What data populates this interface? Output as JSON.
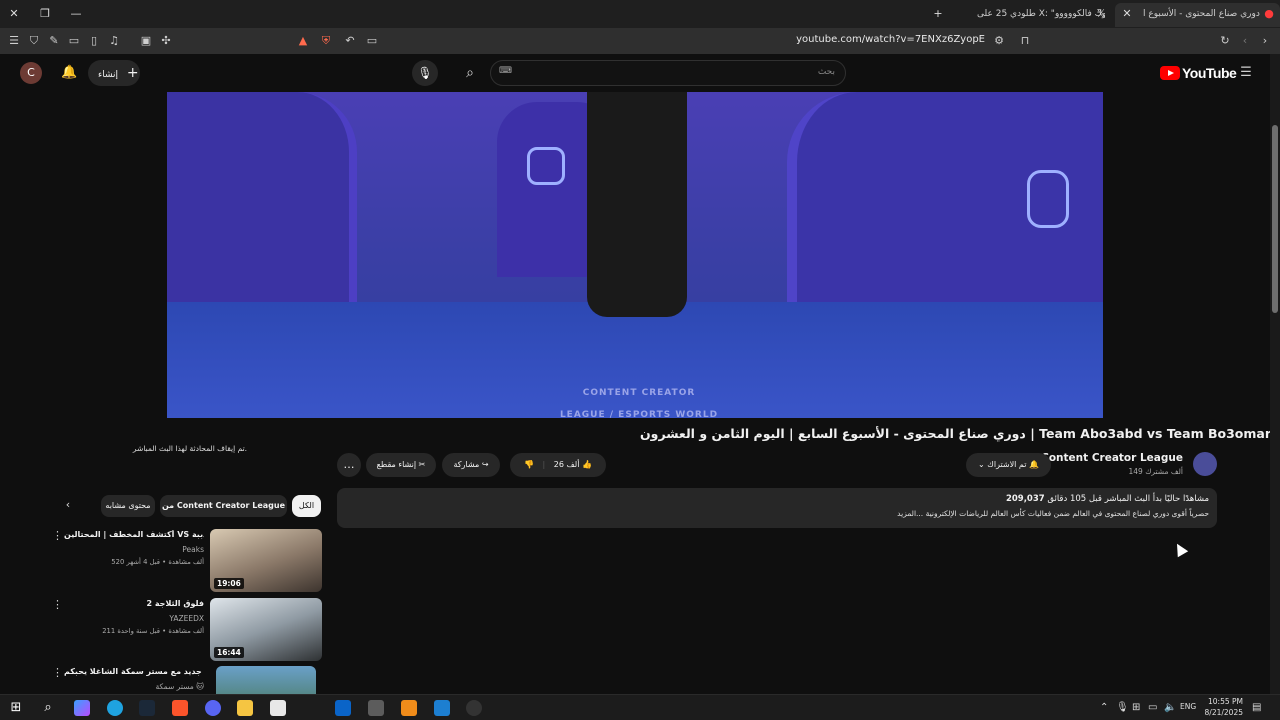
{
  "browser": {
    "tabs": [
      {
        "title": "دوري صناع المحتوى - الأسبوع ا",
        "active": true
      },
      {
        "title": "طلودي 25 على X: \"مرووووك فالكووووو",
        "active": false
      }
    ],
    "url": "youtube.com/watch?v=7ENXz6ZyopE",
    "icons": [
      "close-icon",
      "restore-icon",
      "minimize-icon",
      "new-tab-icon",
      "reload-icon",
      "back-icon",
      "forward-icon",
      "bookmark-icon",
      "brave-shield-icon"
    ]
  },
  "youtube": {
    "logo_text": "YouTube",
    "search_placeholder": "بحث",
    "create_label": "إنشاء",
    "avatar_letter": "C"
  },
  "video": {
    "watermark": "CONTENT CREATOR LEAGUE / ESPORTS WORLD CUP",
    "title": "دوري صناع المحتوى - الأسبوع السابع | اليوم الثامن و العشرون | Team Abo3abd vs Team Bo3omar22",
    "channel": {
      "name": "Content Creator League",
      "subscribers": "149 ألف مشترك",
      "subscribed_label": "تم الاشتراك"
    },
    "actions": {
      "likes": "26 ألف",
      "share": "مشاركة",
      "clip": "إنشاء مقطع",
      "more": "…"
    },
    "description": {
      "views": "209,037",
      "stats_rest": "مشاهدًا حاليًا بدأ البث المباشر قبل 105 دقائق",
      "text": "حصرياً أقوى دوري لصناع المحتوى في العالم ضمن فعاليات كأس العالم للرياضات الإلكترونية ...المزيد"
    }
  },
  "chat_notice": "تم إيقاف المحادثة لهذا البث المباشر.",
  "chips": [
    "الكل",
    "من Content Creator League",
    "محتوى مشابه"
  ],
  "recommendations": [
    {
      "title": "أكتشف المخطف | المحتالين VS الدببة 🫶",
      "channel": "Peaks",
      "meta": "520 ألف مشاهدة • قبل 4 أشهر",
      "duration": "19:06",
      "colors": [
        "#c9b9a4",
        "#3d342e"
      ]
    },
    {
      "title": "فلوق الثلاجة 2",
      "channel": "YAZEEDX",
      "meta": "211 ألف مشاهدة • قبل سنة واحدة",
      "duration": "16:44",
      "colors": [
        "#cfd6dd",
        "#2e3133"
      ]
    },
    {
      "title": "قيم جديد مع مستر سمكة الشاغلا يحبكم 🐱",
      "channel": "مستر سمكة 🐱",
      "meta": "",
      "duration": "",
      "colors": [
        "#6aa0c8",
        "#3c6a3a"
      ]
    }
  ],
  "taskbar": {
    "time": "10:55 PM",
    "date": "8/21/2025",
    "lang": "ENG"
  }
}
